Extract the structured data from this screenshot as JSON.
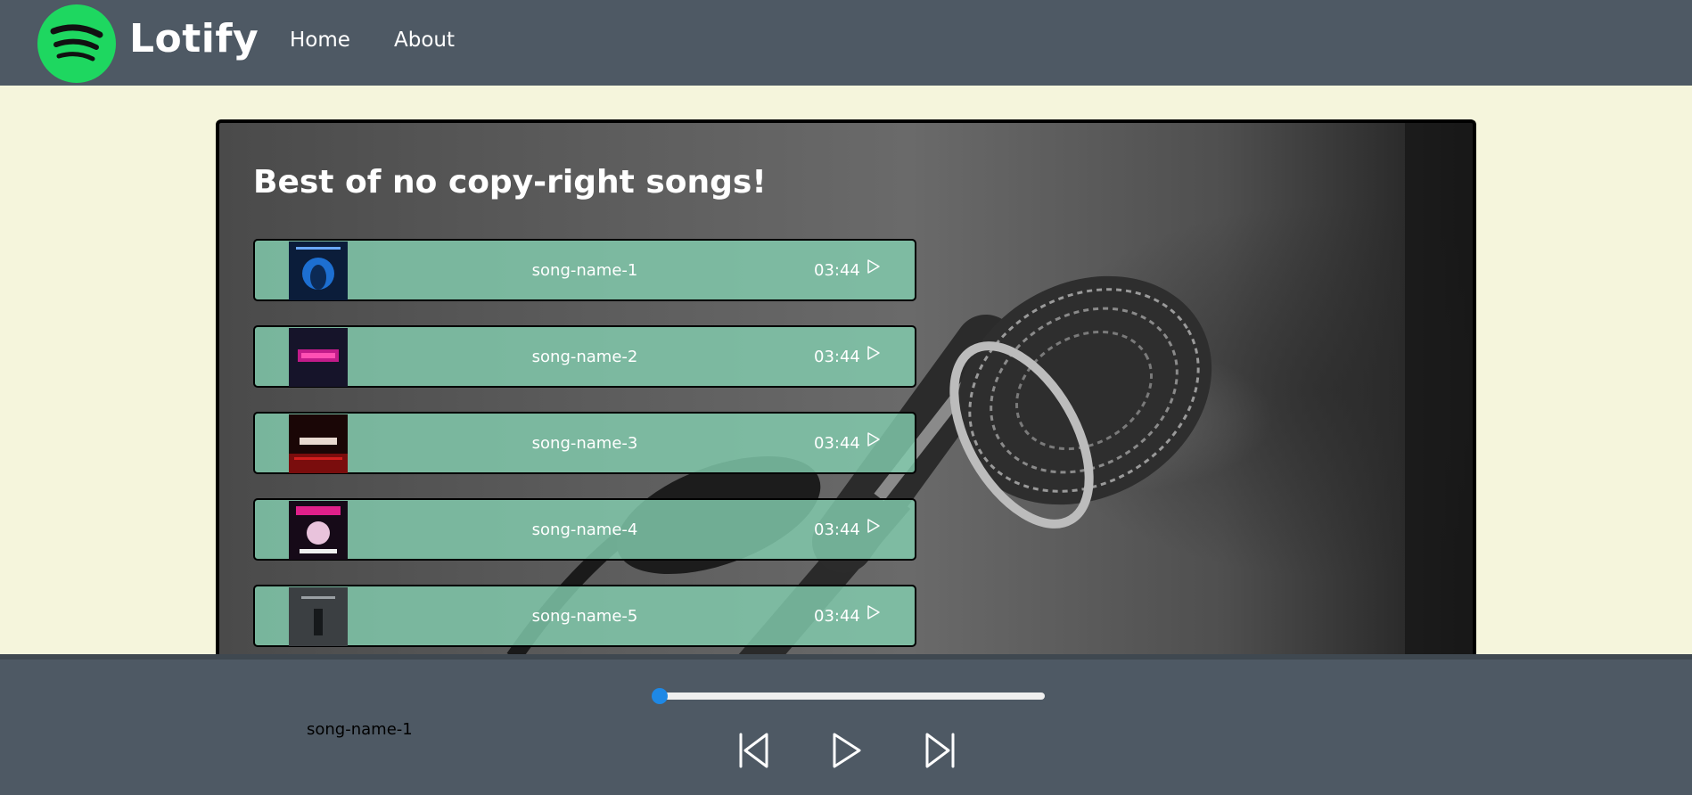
{
  "navbar": {
    "brand": "Lotify",
    "logo_icon": "spotify-logo-icon",
    "links": [
      "Home",
      "About"
    ]
  },
  "main": {
    "title": "Best of no copy-right songs!",
    "songs": [
      {
        "name": "song-name-1",
        "duration": "03:44",
        "cover_icon": "album-cover-legion"
      },
      {
        "name": "song-name-2",
        "duration": "03:44",
        "cover_icon": "album-cover-trap"
      },
      {
        "name": "song-name-3",
        "duration": "03:44",
        "cover_icon": "album-cover-they-mad"
      },
      {
        "name": "song-name-4",
        "duration": "03:44",
        "cover_icon": "album-cover-plug-walk"
      },
      {
        "name": "song-name-5",
        "duration": "03:44",
        "cover_icon": "album-cover-dark"
      }
    ]
  },
  "player": {
    "current_song": "song-name-1",
    "progress": 0,
    "icons": [
      "previous-icon",
      "play-icon",
      "next-icon"
    ]
  },
  "colors": {
    "navbar": "#4e5964",
    "page_background": "#f5f5dc",
    "song_item": "#82cdaf",
    "logo_green": "#1ed760",
    "progress_thumb": "#1e88e5"
  }
}
